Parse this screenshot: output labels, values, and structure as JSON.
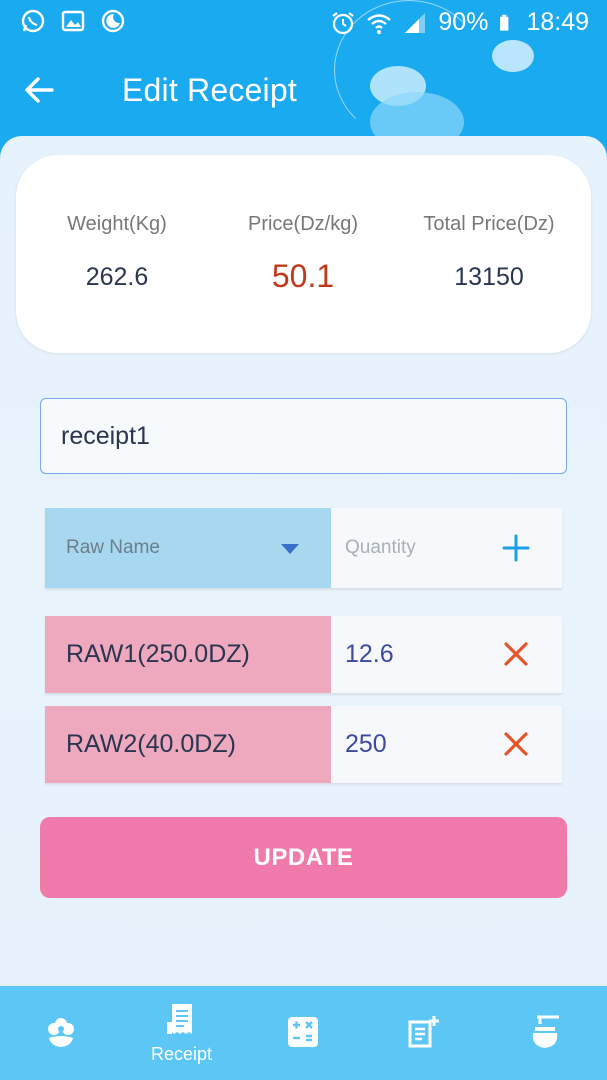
{
  "status_bar": {
    "battery": "90%",
    "time": "18:49",
    "left_icons": [
      "whatsapp-icon",
      "image-icon",
      "do-not-disturb-icon"
    ],
    "right_icons": [
      "alarm-icon",
      "wifi-icon",
      "signal-icon",
      "battery-icon"
    ]
  },
  "header": {
    "title": "Edit Receipt",
    "back_icon": "arrow-left-icon"
  },
  "summary": {
    "weight_label": "Weight(Kg)",
    "weight_value": "262.6",
    "price_label": "Price(Dz/kg)",
    "price_value": "50.1",
    "total_label": "Total Price(Dz)",
    "total_value": "13150"
  },
  "receipt_name": {
    "value": "receipt1"
  },
  "add_row": {
    "raw_name_placeholder": "Raw Name",
    "quantity_placeholder": "Quantity",
    "add_icon": "plus-icon"
  },
  "items": [
    {
      "name": "RAW1(250.0DZ)",
      "quantity": "12.6"
    },
    {
      "name": "RAW2(40.0DZ)",
      "quantity": "250"
    }
  ],
  "update_label": "UPDATE",
  "nav": {
    "items": [
      {
        "icon": "flower-icon",
        "label": ""
      },
      {
        "icon": "receipt-icon",
        "label": "Receipt",
        "active": true
      },
      {
        "icon": "calculator-icon",
        "label": ""
      },
      {
        "icon": "add-note-icon",
        "label": ""
      },
      {
        "icon": "honey-jar-icon",
        "label": ""
      }
    ]
  },
  "colors": {
    "primary": "#1aaaf0",
    "accent_price": "#c0391b",
    "update_button": "#f07aaa",
    "raw_name_bg": "#efa9be",
    "dropdown_bg": "#a7d8ef",
    "delete_icon": "#e8542a",
    "add_icon": "#1aa0e8"
  }
}
